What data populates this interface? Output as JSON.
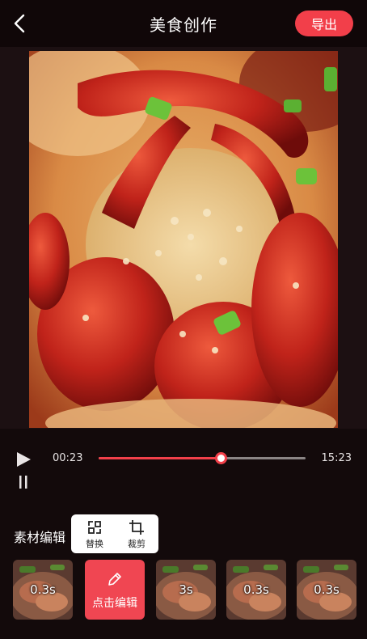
{
  "header": {
    "title": "美食创作",
    "export_label": "导出"
  },
  "player": {
    "current_time": "00:23",
    "total_time": "15:23",
    "progress": 0.59
  },
  "editor": {
    "section_label": "素材编辑",
    "popover": {
      "replace_label": "替换",
      "crop_label": "裁剪"
    },
    "clips": [
      {
        "duration": "0.3s"
      },
      {
        "add_label": "点击编辑"
      },
      {
        "duration": "3s"
      },
      {
        "duration": "0.3s"
      },
      {
        "duration": "0.3s"
      }
    ]
  },
  "colors": {
    "accent": "#f23f4a",
    "background": "#130a0b"
  },
  "icons": [
    "back-arrow-icon",
    "play-icon",
    "pause-icon",
    "replace-icon",
    "crop-icon",
    "pencil-icon"
  ]
}
